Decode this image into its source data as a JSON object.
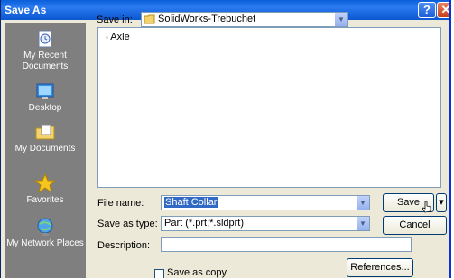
{
  "window": {
    "title": "Save As",
    "help_symbol": "?",
    "close_symbol": "✕"
  },
  "places": [
    {
      "label": "My Recent Documents",
      "icon": "recent-documents-icon"
    },
    {
      "label": "Desktop",
      "icon": "desktop-icon"
    },
    {
      "label": "My Documents",
      "icon": "my-documents-icon"
    },
    {
      "label": "Favorites",
      "icon": "favorites-star-icon"
    },
    {
      "label": "My Network Places",
      "icon": "network-places-icon"
    }
  ],
  "save_in": {
    "label": "Save in:",
    "value": "SolidWorks-Trebuchet"
  },
  "toolbar_icons": [
    "back-icon",
    "up-folder-icon",
    "new-folder-icon",
    "views-menu-icon"
  ],
  "files": [
    {
      "name": "Axle"
    }
  ],
  "file_name": {
    "label": "File name:",
    "value": "Shaft Collar"
  },
  "save_as_type": {
    "label": "Save as type:",
    "value": "Part (*.prt;*.sldprt)"
  },
  "description": {
    "label": "Description:",
    "value": ""
  },
  "buttons": {
    "save": "Save",
    "cancel": "Cancel",
    "references": "References..."
  },
  "save_as_copy": {
    "label": "Save as copy",
    "checked": false
  },
  "colors": {
    "titlebar": "#0a5fd8",
    "dialog_bg": "#ece9d8",
    "places_bg": "#7f7f7f",
    "selection": "#316ac5"
  }
}
